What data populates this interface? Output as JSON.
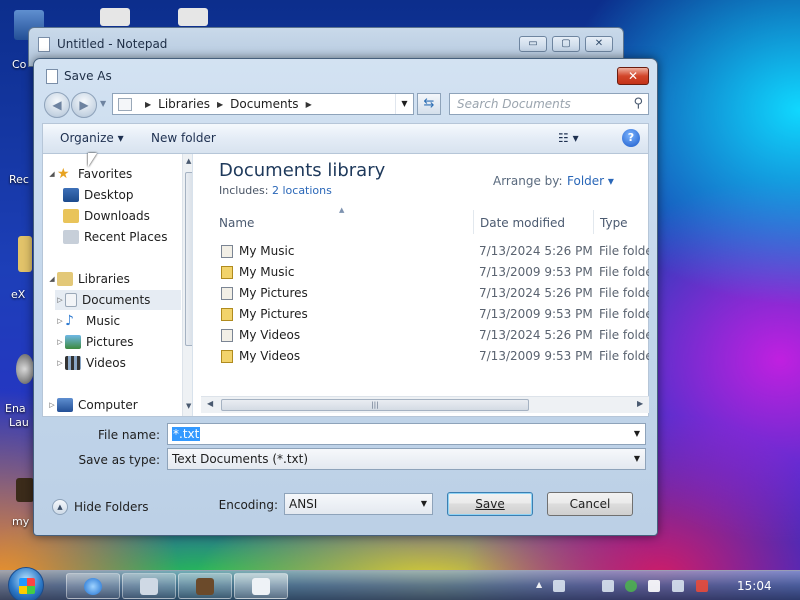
{
  "desktop": {
    "icon_labels": [
      "Co",
      "Rec",
      "eX",
      "Ena",
      "Lau",
      "my"
    ]
  },
  "notepad": {
    "title": "Untitled - Notepad",
    "min": "▭",
    "max": "▢",
    "close": "✕"
  },
  "dialog": {
    "title": "Save As",
    "close": "✕",
    "breadcrumb": [
      "Libraries",
      "Documents"
    ],
    "search_placeholder": "Search Documents",
    "toolbar": {
      "organize": "Organize ▾",
      "new_folder": "New folder"
    },
    "nav": {
      "favorites": "Favorites",
      "desktop": "Desktop",
      "downloads": "Downloads",
      "recent": "Recent Places",
      "libraries": "Libraries",
      "documents": "Documents",
      "music": "Music",
      "pictures": "Pictures",
      "videos": "Videos",
      "computer": "Computer"
    },
    "library": {
      "title": "Documents library",
      "includes_label": "Includes:",
      "includes_link": "2 locations",
      "arrange_label": "Arrange by:",
      "arrange_value": "Folder ▾"
    },
    "columns": {
      "name": "Name",
      "date": "Date modified",
      "type": "Type"
    },
    "rows": [
      {
        "name": "My Music",
        "date": "7/13/2024 5:26 PM",
        "type": "File folder"
      },
      {
        "name": "My Music",
        "date": "7/13/2009 9:53 PM",
        "type": "File folder"
      },
      {
        "name": "My Pictures",
        "date": "7/13/2024 5:26 PM",
        "type": "File folder"
      },
      {
        "name": "My Pictures",
        "date": "7/13/2009 9:53 PM",
        "type": "File folder"
      },
      {
        "name": "My Videos",
        "date": "7/13/2024 5:26 PM",
        "type": "File folder"
      },
      {
        "name": "My Videos",
        "date": "7/13/2009 9:53 PM",
        "type": "File folder"
      }
    ],
    "file_name_label": "File name:",
    "file_name_value": "*.txt",
    "save_type_label": "Save as type:",
    "save_type_value": "Text Documents (*.txt)",
    "hide_folders": "Hide Folders",
    "encoding_label": "Encoding:",
    "encoding_value": "ANSI",
    "save_button": "Save",
    "cancel_button": "Cancel"
  },
  "taskbar": {
    "clock": "15:04"
  }
}
